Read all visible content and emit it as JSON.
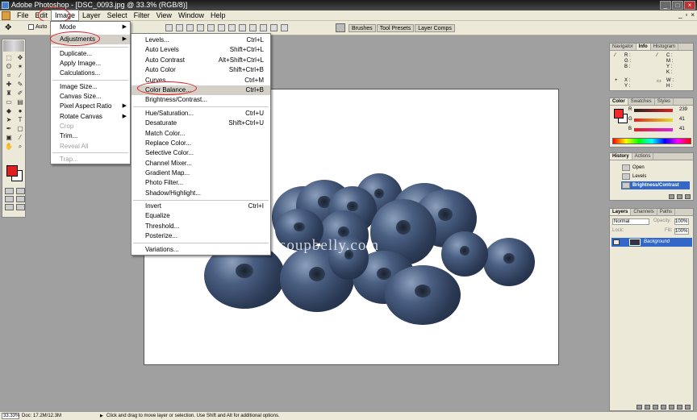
{
  "titlebar": {
    "title": "Adobe Photoshop - [DSC_0093.jpg @ 33.3% (RGB/8)]"
  },
  "menubar": {
    "items": [
      "File",
      "Edit",
      "Image",
      "Layer",
      "Select",
      "Filter",
      "View",
      "Window",
      "Help"
    ]
  },
  "options": {
    "auto_label": "Auto",
    "wells": [
      "Brushes",
      "Tool Presets",
      "Layer Comps"
    ]
  },
  "image_menu": {
    "items": [
      {
        "label": "Mode",
        "submenu": true
      },
      {
        "label": "Adjustments",
        "submenu": true
      },
      {
        "label": "Duplicate..."
      },
      {
        "label": "Apply Image..."
      },
      {
        "label": "Calculations..."
      },
      {
        "label": "Image Size..."
      },
      {
        "label": "Canvas Size..."
      },
      {
        "label": "Pixel Aspect Ratio",
        "submenu": true
      },
      {
        "label": "Rotate Canvas",
        "submenu": true
      },
      {
        "label": "Crop",
        "disabled": true
      },
      {
        "label": "Trim..."
      },
      {
        "label": "Reveal All",
        "disabled": true
      },
      {
        "label": "Trap...",
        "disabled": true
      }
    ]
  },
  "adjustments_menu": {
    "items": [
      {
        "label": "Levels...",
        "shortcut": "Ctrl+L"
      },
      {
        "label": "Auto Levels",
        "shortcut": "Shift+Ctrl+L"
      },
      {
        "label": "Auto Contrast",
        "shortcut": "Alt+Shift+Ctrl+L"
      },
      {
        "label": "Auto Color",
        "shortcut": "Shift+Ctrl+B"
      },
      {
        "label": "Curves...",
        "shortcut": "Ctrl+M"
      },
      {
        "label": "Color Balance...",
        "shortcut": "Ctrl+B"
      },
      {
        "label": "Brightness/Contrast...",
        "shortcut": ""
      },
      {
        "label": "Hue/Saturation...",
        "shortcut": "Ctrl+U"
      },
      {
        "label": "Desaturate",
        "shortcut": "Shift+Ctrl+U"
      },
      {
        "label": "Match Color...",
        "shortcut": ""
      },
      {
        "label": "Replace Color...",
        "shortcut": ""
      },
      {
        "label": "Selective Color...",
        "shortcut": ""
      },
      {
        "label": "Channel Mixer...",
        "shortcut": ""
      },
      {
        "label": "Gradient Map...",
        "shortcut": ""
      },
      {
        "label": "Photo Filter...",
        "shortcut": ""
      },
      {
        "label": "Shadow/Highlight...",
        "shortcut": ""
      },
      {
        "label": "Invert",
        "shortcut": "Ctrl+I"
      },
      {
        "label": "Equalize",
        "shortcut": ""
      },
      {
        "label": "Threshold...",
        "shortcut": ""
      },
      {
        "label": "Posterize...",
        "shortcut": ""
      },
      {
        "label": "Variations...",
        "shortcut": ""
      }
    ]
  },
  "canvas": {
    "watermark": "soupbelly.com"
  },
  "info_panel": {
    "tabs": [
      "Navigator",
      "Info",
      "Histogram"
    ],
    "labels": [
      "R :",
      "G :",
      "B :",
      "C :",
      "M :",
      "Y :",
      "K :",
      "X :",
      "Y :",
      "W :",
      "H :"
    ]
  },
  "color_panel": {
    "tabs": [
      "Color",
      "Swatches",
      "Styles"
    ],
    "channels": [
      {
        "name": "R",
        "value": "239",
        "color": "#e02020"
      },
      {
        "name": "G",
        "value": "41",
        "color": "#c0c000"
      },
      {
        "name": "B",
        "value": "41",
        "color": "#c020c0"
      }
    ],
    "foreground": "#ef2929"
  },
  "history_panel": {
    "tabs": [
      "History",
      "Actions"
    ],
    "items": [
      "Open",
      "Levels",
      "Brightness/Contrast"
    ]
  },
  "layers_panel": {
    "tabs": [
      "Layers",
      "Channels",
      "Paths"
    ],
    "blend_mode": "Normal",
    "opacity_label": "Opacity:",
    "opacity": "100%",
    "lock_label": "Lock:",
    "fill_label": "Fill:",
    "fill": "100%",
    "layer_name": "Background"
  },
  "statusbar": {
    "zoom": "33.33%",
    "doc": "Doc: 17.2M/12.3M",
    "hint": "Click and drag to move layer or selection.  Use Shift and Alt for additional options."
  }
}
